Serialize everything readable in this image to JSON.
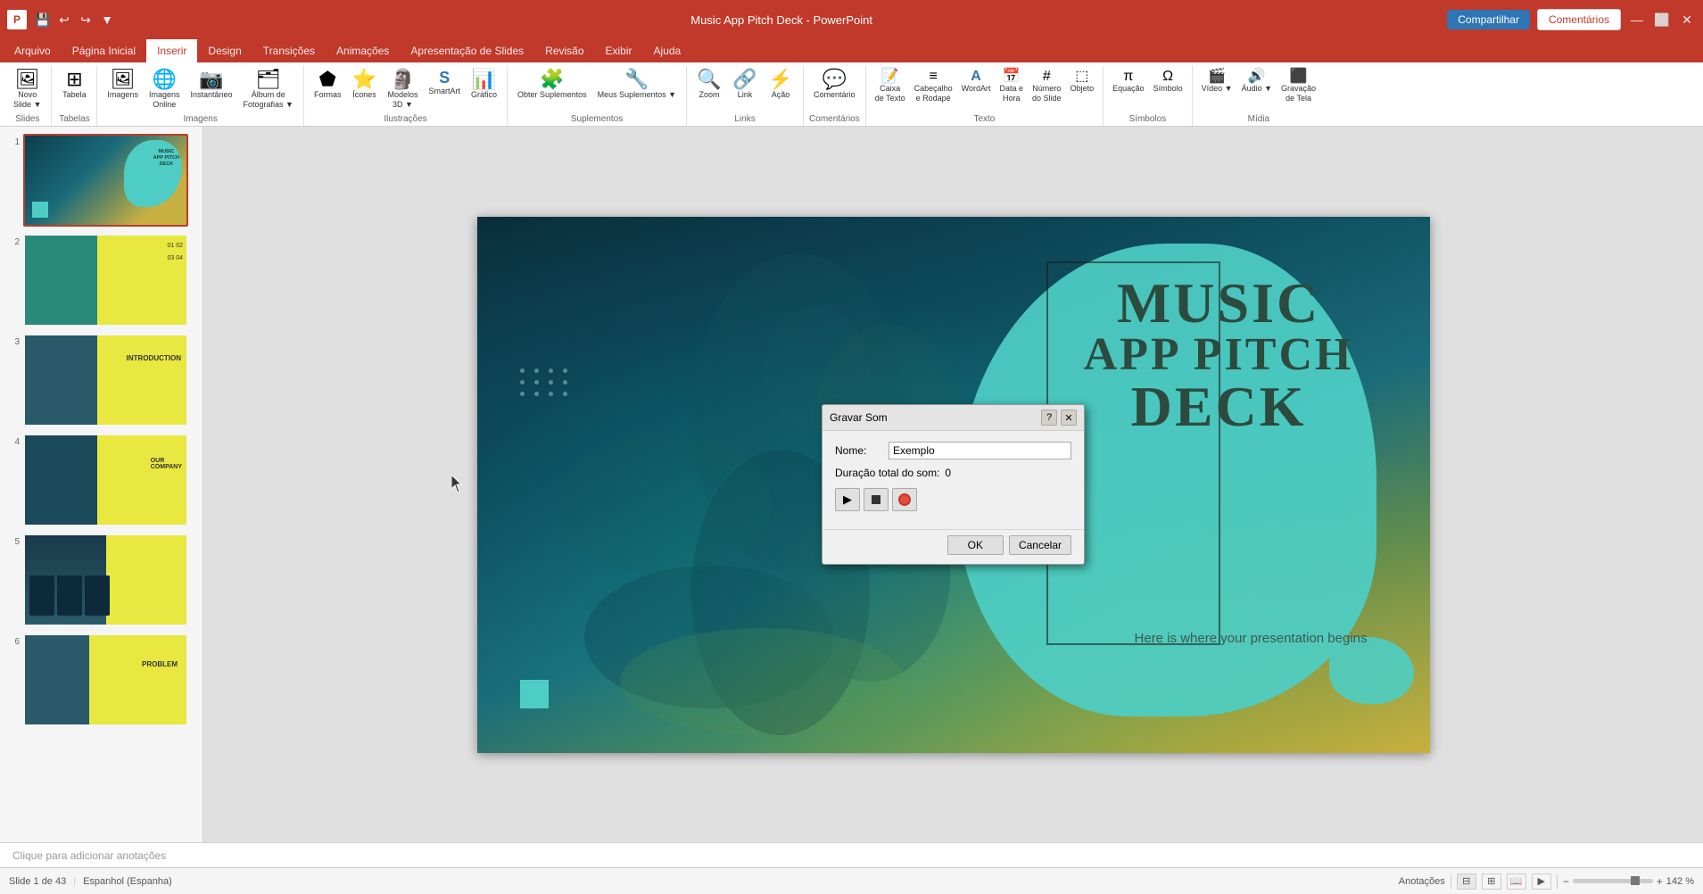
{
  "titlebar": {
    "app": "PowerPoint",
    "filename": "Music App Pitch Deck - PowerPoint"
  },
  "menubar": {
    "items": [
      "Arquivo",
      "Página Inicial",
      "Inserir",
      "Design",
      "Transições",
      "Animações",
      "Apresentação de Slides",
      "Revisão",
      "Exibir",
      "Ajuda"
    ],
    "active": "Inserir"
  },
  "ribbon": {
    "groups": [
      {
        "label": "Slides",
        "items": [
          {
            "icon": "🖼",
            "label": "Novo\nSlide",
            "dropdown": true
          }
        ]
      },
      {
        "label": "Tabelas",
        "items": [
          {
            "icon": "⊞",
            "label": "Tabela"
          }
        ]
      },
      {
        "label": "Imagens",
        "items": [
          {
            "icon": "🖼",
            "label": "Imagens"
          },
          {
            "icon": "🖼",
            "label": "Imagens\nOnline"
          },
          {
            "icon": "📸",
            "label": "Instantâneo"
          },
          {
            "icon": "📷",
            "label": "Álbum de\nFotografias",
            "dropdown": true
          }
        ]
      },
      {
        "label": "Ilustrações",
        "items": [
          {
            "icon": "⬟",
            "label": "Formas"
          },
          {
            "icon": "⭐",
            "label": "Ícones"
          },
          {
            "icon": "🗿",
            "label": "Modelos\n3D",
            "dropdown": true
          },
          {
            "icon": "A",
            "label": "SmartArt"
          },
          {
            "icon": "📊",
            "label": "Gráfico"
          }
        ]
      },
      {
        "label": "Suplementos",
        "items": [
          {
            "icon": "🧩",
            "label": "Obter Suplementos"
          },
          {
            "icon": "🧩",
            "label": "Meus Suplementos",
            "dropdown": true
          }
        ]
      },
      {
        "label": "Links",
        "items": [
          {
            "icon": "🔍",
            "label": "Zoom"
          },
          {
            "icon": "🔗",
            "label": "Link"
          },
          {
            "icon": "⚡",
            "label": "Ação"
          }
        ]
      },
      {
        "label": "Comentários",
        "items": [
          {
            "icon": "💬",
            "label": "Comentário"
          }
        ]
      },
      {
        "label": "Texto",
        "items": [
          {
            "icon": "📝",
            "label": "Caixa\nde Texto"
          },
          {
            "icon": "≡",
            "label": "Cabeçalho\ne Rodapé"
          },
          {
            "icon": "A",
            "label": "WordArt"
          },
          {
            "icon": "📅",
            "label": "Data e\nHora"
          },
          {
            "icon": "#",
            "label": "Número\ndo Slide"
          },
          {
            "icon": "⬚",
            "label": "Objeto"
          }
        ]
      },
      {
        "label": "Símbolos",
        "items": [
          {
            "icon": "Σ",
            "label": "Equação"
          },
          {
            "icon": "Ω",
            "label": "Símbolo"
          }
        ]
      },
      {
        "label": "Mídia",
        "items": [
          {
            "icon": "🎬",
            "label": "Vídeo",
            "dropdown": true
          },
          {
            "icon": "🔊",
            "label": "Áudio",
            "dropdown": true
          },
          {
            "icon": "⬛",
            "label": "Gravação\nde Tela"
          }
        ]
      }
    ],
    "share_label": "Compartilhar",
    "comments_label": "Comentários"
  },
  "slides": [
    {
      "num": "1",
      "active": true
    },
    {
      "num": "2",
      "active": false
    },
    {
      "num": "3",
      "active": false
    },
    {
      "num": "4",
      "active": false
    },
    {
      "num": "5",
      "active": false
    },
    {
      "num": "6",
      "active": false
    }
  ],
  "slide_main": {
    "title_line1": "MUSIC",
    "title_line2": "APP PITCH",
    "title_line3": "DECK",
    "subtitle": "Here is where your presentation begins"
  },
  "dialog": {
    "title": "Gravar Som",
    "name_label": "Nome:",
    "name_value": "Exemplo",
    "duration_label": "Duração total do som:",
    "duration_value": "0",
    "ok_label": "OK",
    "cancel_label": "Cancelar"
  },
  "notes": {
    "placeholder": "Clique para adicionar anotações"
  },
  "statusbar": {
    "slide_info": "Slide 1 de 43",
    "language": "Espanhol (Espanha)",
    "notes_label": "Anotações",
    "zoom": "142 %"
  }
}
